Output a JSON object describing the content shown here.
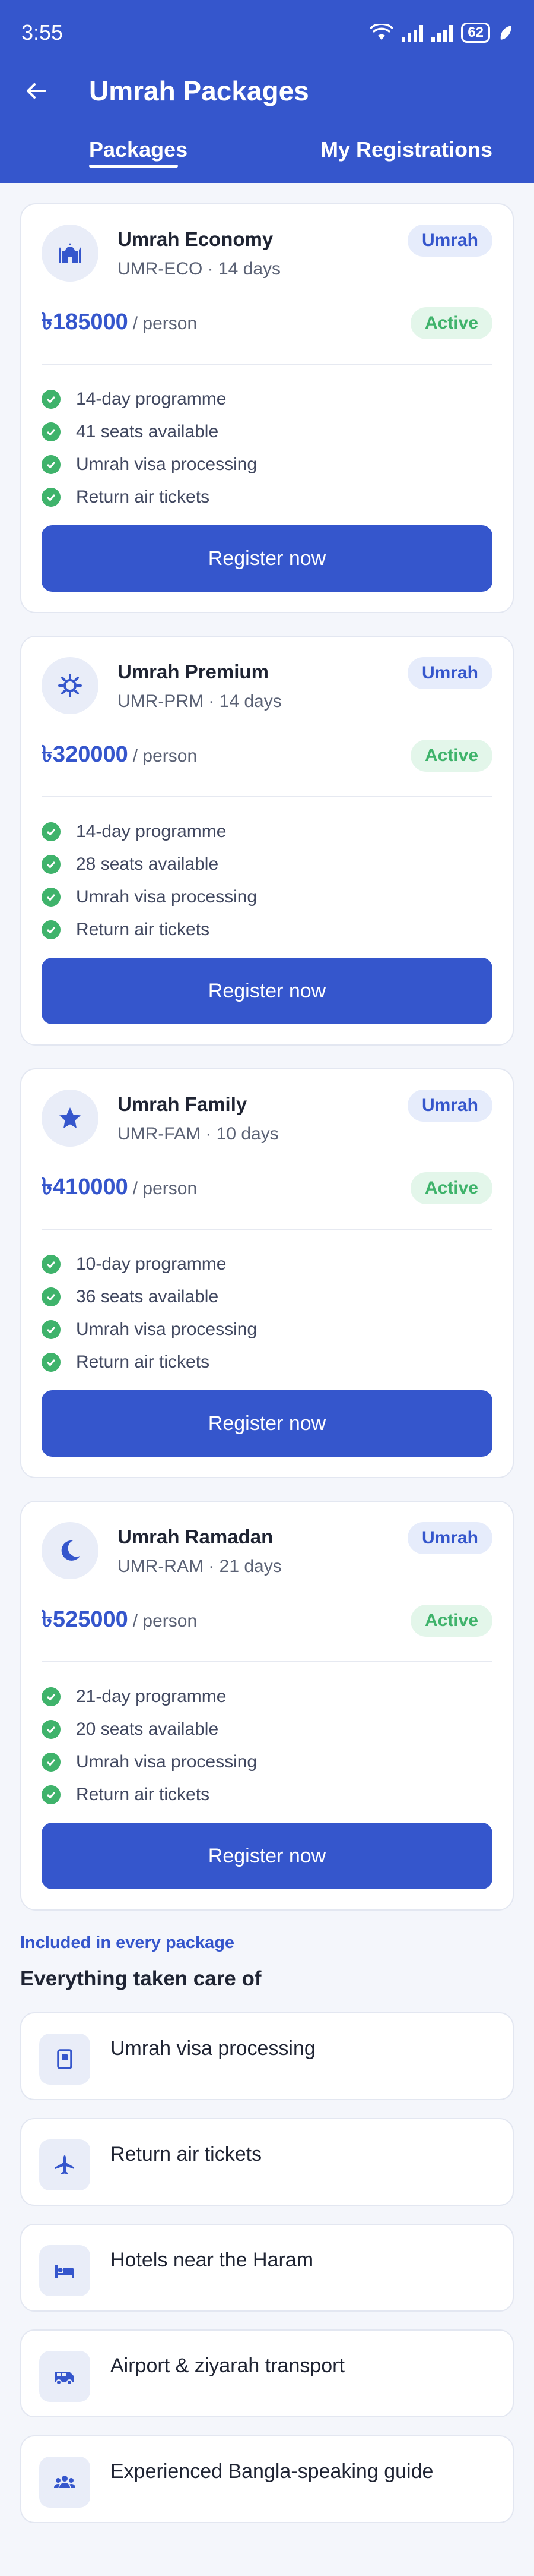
{
  "status_bar": {
    "time": "3:55",
    "battery": "62"
  },
  "app_bar": {
    "title": "Umrah Packages"
  },
  "tabs": [
    {
      "label": "Packages",
      "active": true
    },
    {
      "label": "My Registrations",
      "active": false
    }
  ],
  "packages": [
    {
      "icon": "mosque-icon",
      "name": "Umrah Economy",
      "meta": "UMR-ECO  ·  14 days",
      "type": "Umrah",
      "price": "৳185000",
      "per": "/ person",
      "status": "Active",
      "features": [
        "14-day programme",
        "41 seats available",
        "Umrah visa processing",
        "Return air tickets"
      ],
      "button": "Register now"
    },
    {
      "icon": "sun-icon",
      "name": "Umrah Premium",
      "meta": "UMR-PRM  ·  14 days",
      "type": "Umrah",
      "price": "৳320000",
      "per": "/ person",
      "status": "Active",
      "features": [
        "14-day programme",
        "28 seats available",
        "Umrah visa processing",
        "Return air tickets"
      ],
      "button": "Register now"
    },
    {
      "icon": "star-icon",
      "name": "Umrah Family",
      "meta": "UMR-FAM  ·  10 days",
      "type": "Umrah",
      "price": "৳410000",
      "per": "/ person",
      "status": "Active",
      "features": [
        "10-day programme",
        "36 seats available",
        "Umrah visa processing",
        "Return air tickets"
      ],
      "button": "Register now"
    },
    {
      "icon": "moon-icon",
      "name": "Umrah Ramadan",
      "meta": "UMR-RAM  ·  21 days",
      "type": "Umrah",
      "price": "৳525000",
      "per": "/ person",
      "status": "Active",
      "features": [
        "21-day programme",
        "20 seats available",
        "Umrah visa processing",
        "Return air tickets"
      ],
      "button": "Register now"
    }
  ],
  "included": {
    "label": "Included in every package",
    "title": "Everything taken care of",
    "items": [
      {
        "icon": "passport-icon",
        "label": "Umrah visa processing"
      },
      {
        "icon": "airplane-icon",
        "label": "Return air tickets"
      },
      {
        "icon": "hotel-bed-icon",
        "label": "Hotels near the Haram"
      },
      {
        "icon": "bus-icon",
        "label": "Airport & ziyarah transport"
      },
      {
        "icon": "group-icon",
        "label": "Experienced Bangla-speaking guide"
      }
    ]
  },
  "colors": {
    "primary": "#3556cc",
    "success": "#3fb36b",
    "background": "#f4f6fb"
  }
}
